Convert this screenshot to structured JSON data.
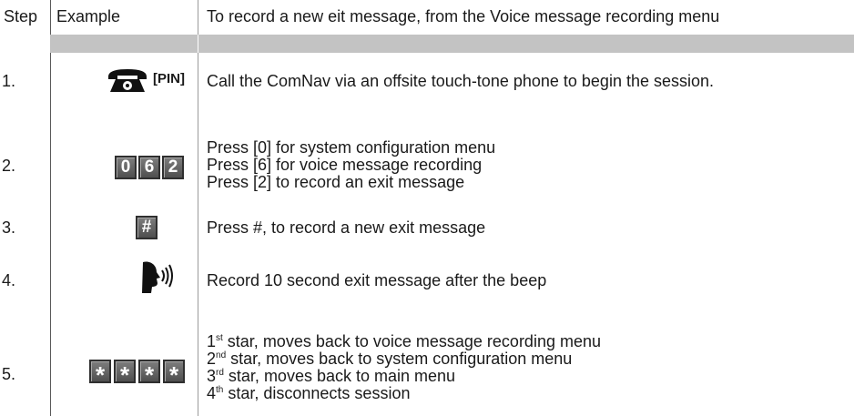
{
  "header": {
    "step": "Step",
    "example": "Example",
    "description": "To record a new eit message, from the Voice message recording menu"
  },
  "rows": [
    {
      "step": "1.",
      "example": {
        "icon": "telephone-icon",
        "label": "[PIN]"
      },
      "lines": [
        "Call the ComNav via an offsite touch-tone phone to begin the session."
      ]
    },
    {
      "step": "2.",
      "example": {
        "keys": [
          "0",
          "6",
          "2"
        ]
      },
      "lines": [
        "Press [0] for system configuration menu",
        "Press [6] for voice message recording",
        "Press [2] to record an exit message"
      ]
    },
    {
      "step": "3.",
      "example": {
        "keys": [
          "#"
        ]
      },
      "lines": [
        "Press #, to record a new exit message"
      ]
    },
    {
      "step": "4.",
      "example": {
        "icon": "speaking-head-icon"
      },
      "lines": [
        "Record 10 second exit message after the beep"
      ]
    },
    {
      "step": "5.",
      "example": {
        "keys": [
          "*",
          "*",
          "*",
          "*"
        ]
      },
      "lines": [
        {
          "num": "1",
          "sup": "st",
          "text": " star, moves back to voice message recording menu"
        },
        {
          "num": "2",
          "sup": "nd",
          "text": " star, moves back to system configuration menu"
        },
        {
          "num": "3",
          "sup": "rd",
          "text": " star, moves back to main menu"
        },
        {
          "num": "4",
          "sup": "th",
          "text": " star, disconnects session"
        }
      ]
    }
  ],
  "colors": {
    "rule": "#5a5a5a",
    "band": "#c3c3c3",
    "key_fill": "#666666",
    "key_text": "#ffffff"
  }
}
